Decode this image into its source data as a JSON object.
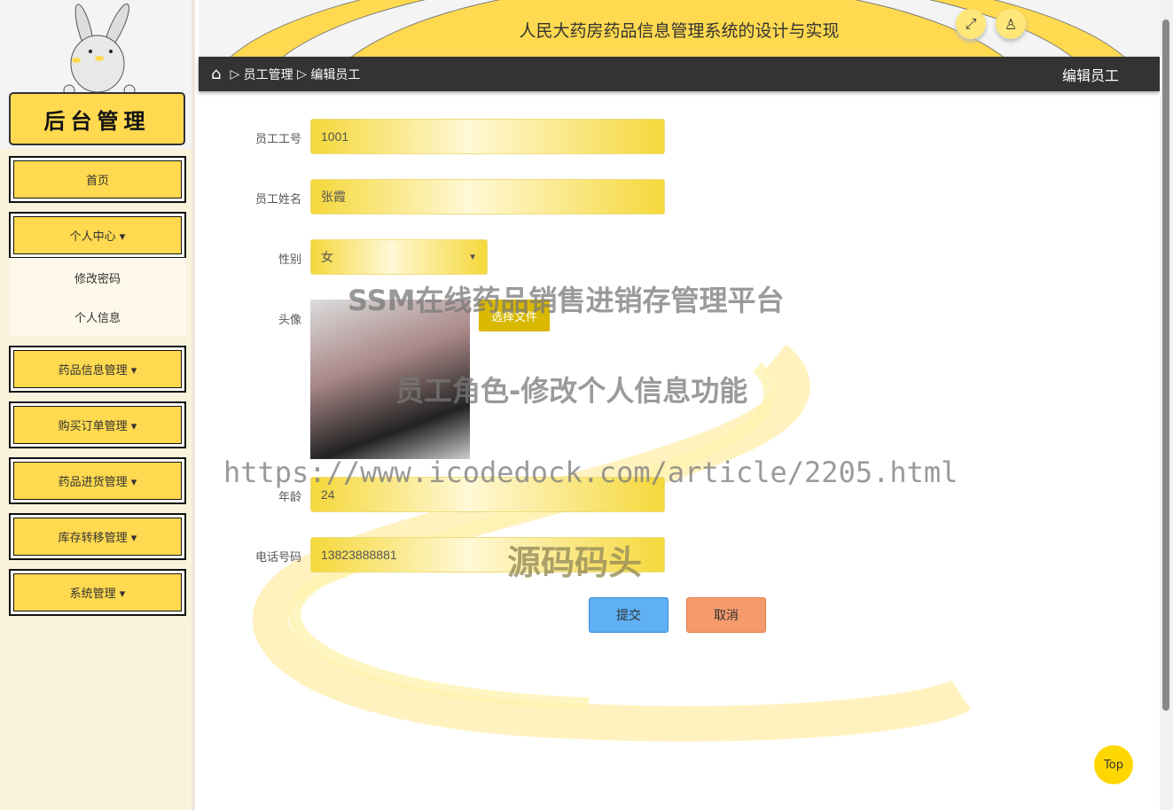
{
  "sidebar": {
    "logo_text": "后台管理",
    "items": [
      {
        "label": "首页"
      },
      {
        "label": "个人中心 ▾"
      },
      {
        "label": "药品信息管理 ▾"
      },
      {
        "label": "购买订单管理 ▾"
      },
      {
        "label": "药品进货管理 ▾"
      },
      {
        "label": "库存转移管理 ▾"
      },
      {
        "label": "系统管理 ▾"
      }
    ],
    "subitems": [
      {
        "label": "修改密码"
      },
      {
        "label": "个人信息"
      }
    ]
  },
  "header": {
    "title": "人民大药房药品信息管理系统的设计与实现",
    "icons": [
      "fullscreen-icon",
      "user-icon"
    ]
  },
  "breadcrumb": {
    "items": [
      "员工管理",
      "编辑员工"
    ],
    "current": "编辑员工"
  },
  "form": {
    "fields": [
      {
        "label": "员工工号",
        "value": "1001"
      },
      {
        "label": "员工姓名",
        "value": "张霞"
      },
      {
        "label": "性别",
        "value": "女"
      },
      {
        "label": "头像",
        "button": "选择文件"
      },
      {
        "label": "年龄",
        "value": "24"
      },
      {
        "label": "电话号码",
        "value": "13823888881"
      }
    ],
    "submit": "提交",
    "cancel": "取消"
  },
  "watermarks": [
    "SSM在线药品销售进销存管理平台",
    "员工角色-修改个人信息功能",
    "https://www.icodedock.com/article/2205.html",
    "源码码头"
  ],
  "top_button": "Top",
  "colors": {
    "accent": "#ffd94f",
    "dark": "#333333",
    "submit": "#5fb0f5",
    "cancel": "#f59a6b"
  }
}
